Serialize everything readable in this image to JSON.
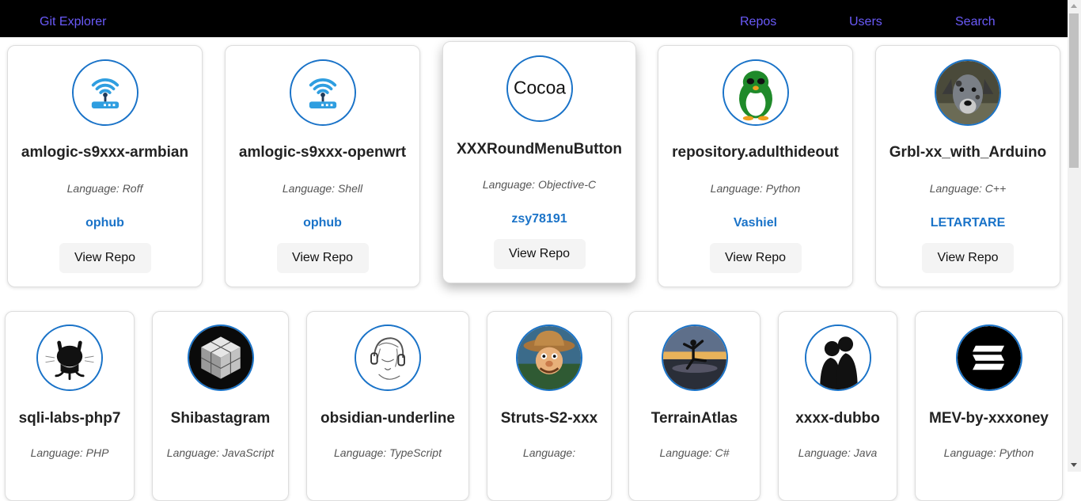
{
  "navbar": {
    "brand": "Git Explorer",
    "links": [
      "Repos",
      "Users",
      "Search"
    ]
  },
  "colors": {
    "nav_link": "#6a5af9",
    "owner_link": "#1a73c8",
    "avatar_border": "#1a73c8"
  },
  "button_label": "View Repo",
  "repos": [
    {
      "name": "amlogic-s9xxx-armbian",
      "language": "Language: Roff",
      "owner": "ophub",
      "avatar_icon": "wifi-router-icon"
    },
    {
      "name": "amlogic-s9xxx-openwrt",
      "language": "Language: Shell",
      "owner": "ophub",
      "avatar_icon": "wifi-router-icon"
    },
    {
      "name": "XXXRoundMenuButton",
      "language": "Language: Objective-C",
      "owner": "zsy78191",
      "avatar_icon": "cocoa-text-icon",
      "avatar_text": "Cocoa"
    },
    {
      "name": "repository.adulthideout",
      "language": "Language: Python",
      "owner": "Vashiel",
      "avatar_icon": "penguin-icon"
    },
    {
      "name": "Grbl-xx_with_Arduino",
      "language": "Language: C++",
      "owner": "LETARTARE",
      "avatar_icon": "dog-photo-icon"
    },
    {
      "name": "sqli-labs-php7",
      "language": "Language: PHP",
      "avatar_icon": "github-octocat-icon"
    },
    {
      "name": "Shibastagram",
      "language": "Language: JavaScript",
      "avatar_icon": "glass-cube-icon"
    },
    {
      "name": "obsidian-underline",
      "language": "Language: TypeScript",
      "avatar_icon": "sketch-headphones-icon"
    },
    {
      "name": "Struts-S2-xxx",
      "language": "Language:",
      "avatar_icon": "cowboy-cartoon-icon"
    },
    {
      "name": "TerrainAtlas",
      "language": "Language: C#",
      "avatar_icon": "sunset-silhouette-icon"
    },
    {
      "name": "xxxx-dubbo",
      "language": "Language: Java",
      "avatar_icon": "couple-silhouette-icon"
    },
    {
      "name": "MEV-by-xxxoney",
      "language": "Language: Python",
      "avatar_icon": "solana-logo-icon"
    }
  ]
}
